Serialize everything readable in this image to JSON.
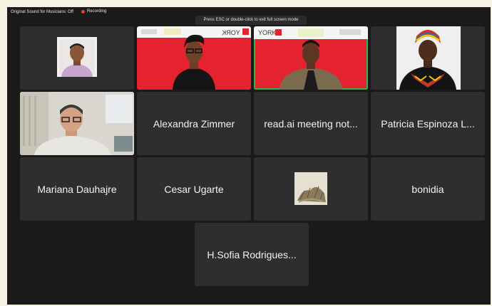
{
  "status": {
    "sound_label": "Original Sound for Musicians: Off",
    "recording_label": "Recording",
    "recording_color": "#e0413a"
  },
  "fullscreen_hint": "Press ESC or double-click to exit full screen mode",
  "brand_text": "YORK",
  "participants": [
    {
      "name": "",
      "kind": "avatar-photo"
    },
    {
      "name": "",
      "kind": "video",
      "banner": "YORK"
    },
    {
      "name": "",
      "kind": "video",
      "banner": "YORK",
      "active_speaker": true
    },
    {
      "name": "",
      "kind": "video"
    },
    {
      "name": "",
      "kind": "video"
    },
    {
      "name": "Alexandra Zimmer"
    },
    {
      "name": "read.ai meeting not..."
    },
    {
      "name": "Patricia Espinoza L..."
    },
    {
      "name": "Mariana Dauhajre"
    },
    {
      "name": "Cesar Ugarte"
    },
    {
      "name": "",
      "kind": "thumbnail"
    },
    {
      "name": "bonidia"
    },
    {
      "name": "H.Sofia Rodrigues..."
    }
  ],
  "colors": {
    "active_border": "#2fb54a",
    "brand_red": "#e4232e",
    "tile_bg": "#2e2e2e"
  }
}
